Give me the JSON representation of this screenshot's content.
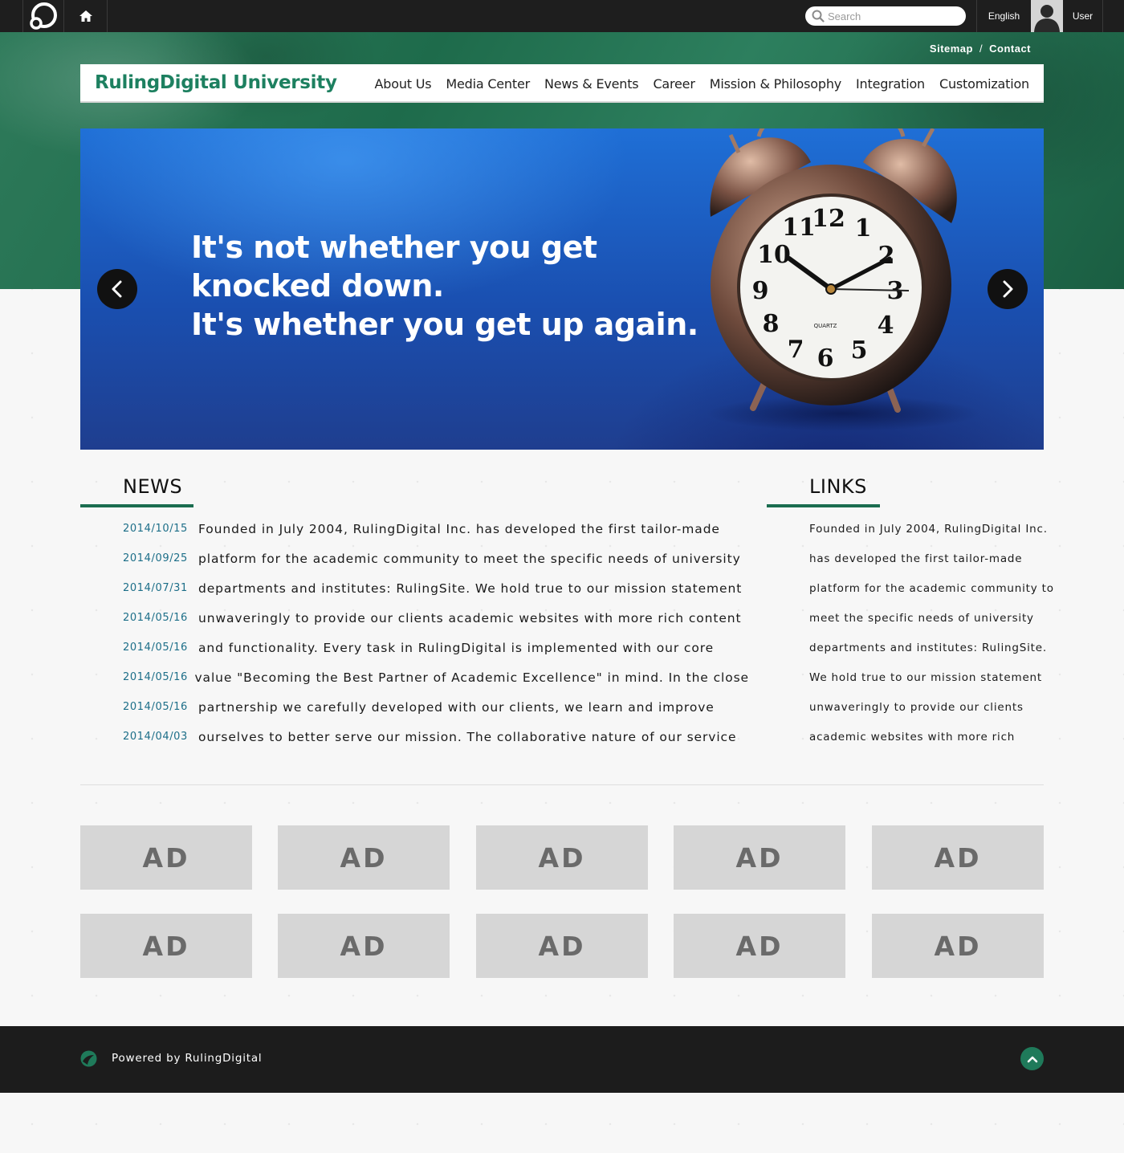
{
  "topbar": {
    "search_placeholder": "Search",
    "language_label": "English",
    "user_label": "User"
  },
  "utility": {
    "sitemap": "Sitemap",
    "separator": "/",
    "contact": "Contact"
  },
  "header": {
    "site_title": "RulingDigital University",
    "nav": [
      "About Us",
      "Media Center",
      "News & Events",
      "Career",
      "Mission & Philosophy",
      "Integration",
      "Customization"
    ]
  },
  "slider": {
    "quote_lines": [
      "It's not whether you get",
      "knocked down.",
      "It's whether you get up again."
    ],
    "clock_label": "QUARTZ"
  },
  "news": {
    "heading": "NEWS",
    "items": [
      {
        "date": "2014/10/15",
        "text": "Founded in July 2004, RulingDigital Inc. has developed the first tailor-made"
      },
      {
        "date": "2014/09/25",
        "text": "platform for the academic community to meet the specific needs of university"
      },
      {
        "date": "2014/07/31",
        "text": "departments and institutes: RulingSite. We hold true to our mission statement"
      },
      {
        "date": "2014/05/16",
        "text": "unwaveringly to provide our clients academic websites with more rich content"
      },
      {
        "date": "2014/05/16",
        "text": "and functionality. Every task in RulingDigital is implemented with our core"
      },
      {
        "date": "2014/05/16",
        "text": "value \"Becoming the Best Partner of Academic Excellence\" in mind. In the close"
      },
      {
        "date": "2014/05/16",
        "text": "partnership we carefully developed with our clients, we learn and improve"
      },
      {
        "date": "2014/04/03",
        "text": "ourselves to better serve our mission. The collaborative nature of our service"
      }
    ]
  },
  "links": {
    "heading": "LINKS",
    "items": [
      "Founded in July 2004, RulingDigital Inc.",
      "has developed the first tailor-made",
      "platform for the academic community to",
      "meet the specific needs of university",
      "departments and institutes: RulingSite.",
      "We hold true to our mission statement",
      "unwaveringly to provide our clients",
      "academic websites with more rich"
    ]
  },
  "ads": [
    "AD",
    "AD",
    "AD",
    "AD",
    "AD",
    "AD",
    "AD",
    "AD",
    "AD",
    "AD"
  ],
  "footer": {
    "powered_by": "Powered by RulingDigital"
  },
  "icons": {
    "logo": "logo-icon",
    "home": "home-icon",
    "search": "search-icon",
    "prev": "chevron-left-icon",
    "next": "chevron-right-icon",
    "to_top": "chevron-up-icon"
  },
  "colors": {
    "brand_green": "#1d8060",
    "topbar": "#1e1e1e",
    "date_blue": "#1c6e88",
    "ad_gray": "#d6d6d6"
  }
}
